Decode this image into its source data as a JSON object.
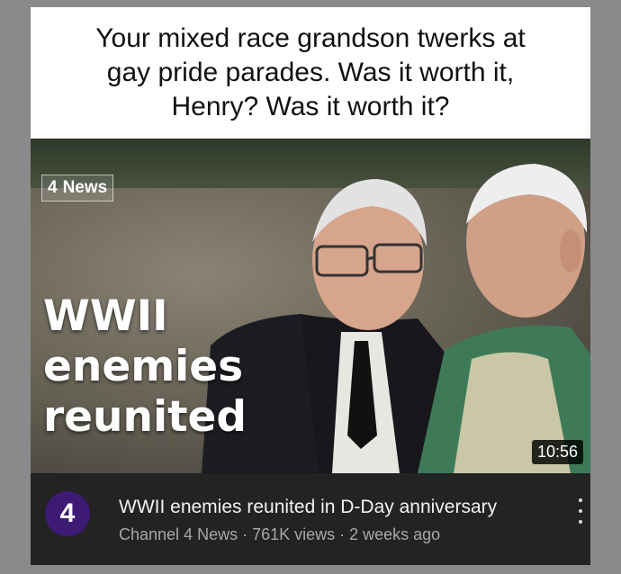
{
  "caption": {
    "lines": [
      "Your mixed race grandson twerks at",
      "gay pride parades. Was it worth it,",
      "Henry? Was it worth it?"
    ]
  },
  "thumbnail": {
    "logo_number": "4",
    "logo_label": "News",
    "headline": [
      "WWII",
      "enemies",
      "reunited"
    ],
    "duration": "10:56"
  },
  "video": {
    "channel_avatar": "4",
    "title": "WWII enemies reunited in D-Day anniversary",
    "meta": "Channel 4 News · 761K views · 2 weeks ago"
  },
  "colors": {
    "avatar_bg": "#3d1a73",
    "info_bg": "#232323"
  },
  "icons": [
    "channel-4-logo-icon",
    "more-options-icon"
  ]
}
